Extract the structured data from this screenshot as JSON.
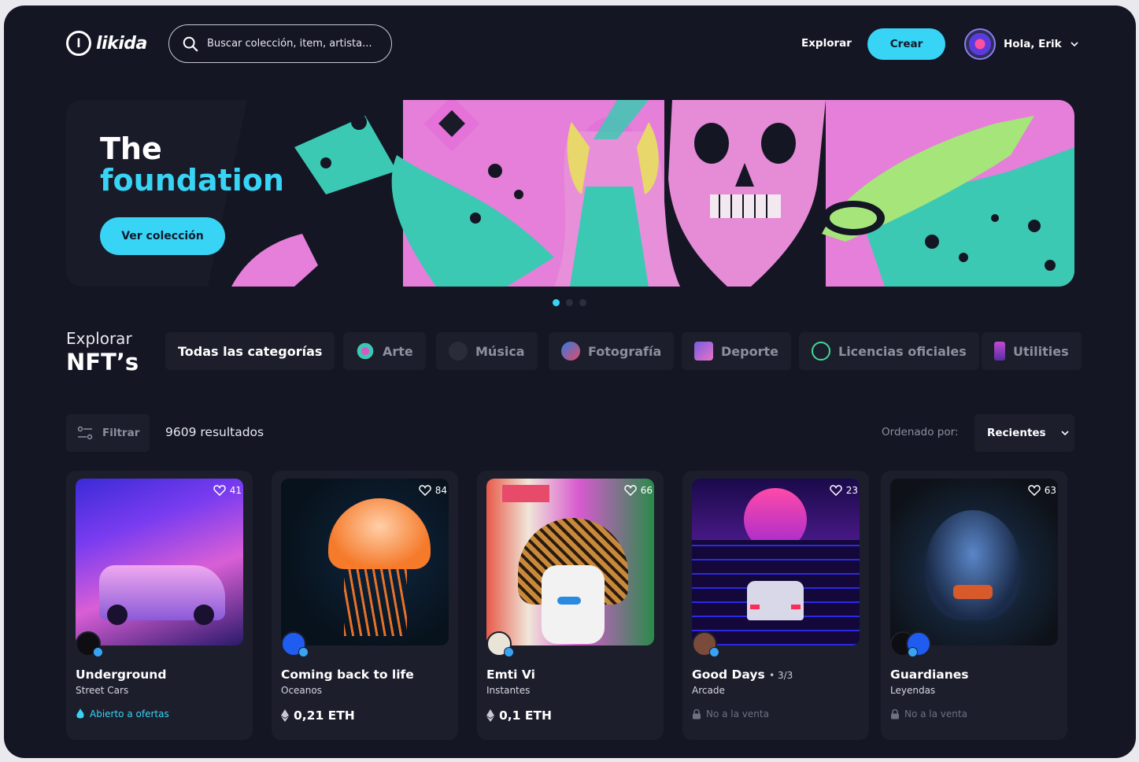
{
  "header": {
    "logo_text": "likida",
    "logo_mark": "l",
    "search_placeholder": "Buscar colección, item, artista...",
    "nav_explorar": "Explorar",
    "crear_label": "Crear",
    "user_greeting": "Hola, Erik"
  },
  "banner": {
    "title_line1": "The",
    "title_line2": "foundation",
    "cta_label": "Ver colección",
    "slides": 3,
    "active_slide": 1
  },
  "explore": {
    "label_small": "Explorar",
    "label_big": "NFT’s",
    "categories": [
      {
        "label": "Todas las categorías",
        "icon": "none",
        "active": true
      },
      {
        "label": "Arte",
        "icon": "art-icon",
        "active": false
      },
      {
        "label": "Música",
        "icon": "music-icon",
        "active": false
      },
      {
        "label": "Fotografía",
        "icon": "photo-icon",
        "active": false
      },
      {
        "label": "Deporte",
        "icon": "sport-icon",
        "active": false
      },
      {
        "label": "Licencias oficiales",
        "icon": "license-icon",
        "active": false
      },
      {
        "label": "Utilities",
        "icon": "utilities-icon",
        "active": false
      }
    ]
  },
  "toolbar": {
    "filter_label": "Filtrar",
    "results": "9609 resultados",
    "ordered_label": "Ordenado por:",
    "sort_value": "Recientes"
  },
  "cards": [
    {
      "title": "Underground",
      "edition": "",
      "subtitle": "Street Cars",
      "likes": "41",
      "status": "Abierto a ofertas",
      "status_type": "open"
    },
    {
      "title": "Coming back to life",
      "edition": "",
      "subtitle": "Oceanos",
      "likes": "84",
      "status": "0,21 ETH",
      "status_type": "price"
    },
    {
      "title": "Emti Vi",
      "edition": "",
      "subtitle": "Instantes",
      "likes": "66",
      "status": "0,1 ETH",
      "status_type": "price"
    },
    {
      "title": "Good Days",
      "edition": "• 3/3",
      "subtitle": "Arcade",
      "likes": "23",
      "status": "No a la venta",
      "status_type": "locked"
    },
    {
      "title": "Guardianes",
      "edition": "",
      "subtitle": "Leyendas",
      "likes": "63",
      "status": "No a la venta",
      "status_type": "locked"
    }
  ],
  "colors": {
    "background": "#141624",
    "surface": "#1c1e2c",
    "accent": "#38d4f5",
    "muted": "#8d8f9f"
  }
}
